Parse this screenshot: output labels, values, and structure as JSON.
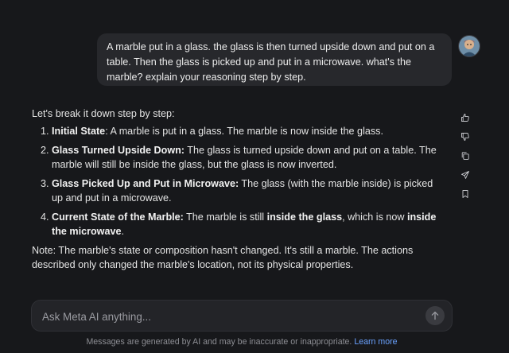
{
  "user_message": {
    "text": "A marble put in a glass. the glass is then turned upside down and put on a table. Then the glass is picked up and put in a microwave. what's the marble? explain your reasoning step by step."
  },
  "user_avatar": {
    "icon": "user-avatar-image"
  },
  "response": {
    "intro": "Let's break it down step by step:",
    "steps": [
      {
        "title": "Initial State",
        "text": ": A marble is put in a glass. The marble is now inside the glass."
      },
      {
        "title": "Glass Turned Upside Down:",
        "text": " The glass is turned upside down and put on a table. The marble will still be inside the glass, but the glass is now inverted."
      },
      {
        "title": "Glass Picked Up and Put in Microwave:",
        "text": " The glass (with the marble inside) is picked up and put in a microwave."
      },
      {
        "title": "Current State of the Marble:",
        "text_a": " The marble is still ",
        "bold_a": "inside the glass",
        "text_b": ", which is now ",
        "bold_b": "inside the microwave",
        "text_c": "."
      }
    ],
    "note": "Note: The marble's state or composition hasn't changed. It's still a marble. The actions described only changed the marble's location, not its physical properties."
  },
  "actions": [
    {
      "icon": "thumbs-up-icon"
    },
    {
      "icon": "thumbs-down-icon"
    },
    {
      "icon": "copy-icon"
    },
    {
      "icon": "share-icon"
    },
    {
      "icon": "bookmark-icon"
    }
  ],
  "composer": {
    "placeholder": "Ask Meta AI anything...",
    "value": "",
    "send_icon": "arrow-up-icon"
  },
  "footer": {
    "text": "Messages are generated by AI and may be inaccurate or inappropriate. ",
    "link": "Learn more"
  },
  "colors": {
    "background": "#17181b",
    "bubble": "#27282c",
    "link": "#6aa2ff",
    "muted": "#8d8e94"
  }
}
